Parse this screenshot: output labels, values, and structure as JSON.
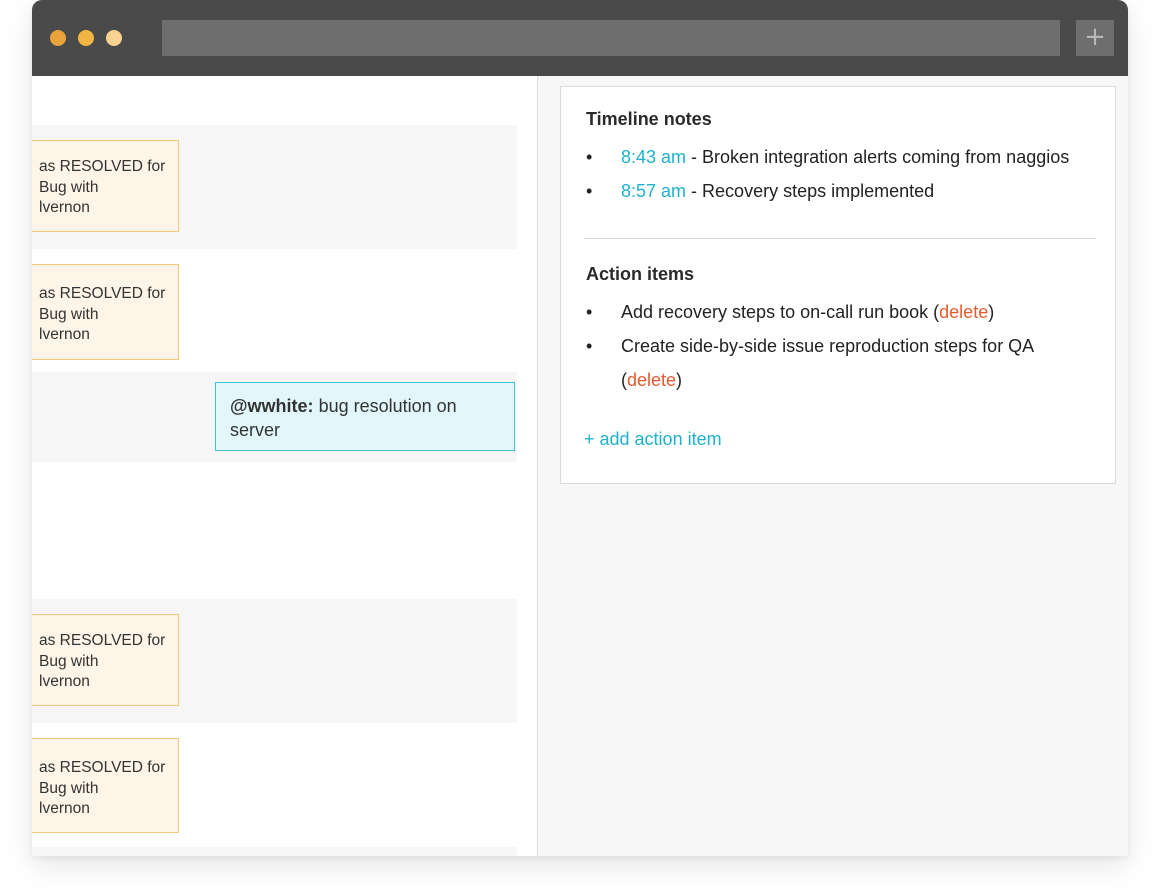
{
  "titlebar": {
    "new_tab_label": "+",
    "traffic_light_colors": [
      "#e8a33a",
      "#f2b544",
      "#f8d292"
    ]
  },
  "timeline": {
    "events": [
      {
        "lines": [
          "as RESOLVED for",
          "Bug with",
          "lvernon"
        ]
      },
      {
        "lines": [
          "as RESOLVED for",
          "Bug with",
          "lvernon"
        ]
      },
      {
        "lines": [
          "as RESOLVED for",
          "Bug with",
          "lvernon"
        ]
      },
      {
        "lines": [
          "as RESOLVED for",
          "Bug with",
          "lvernon"
        ]
      }
    ],
    "comment": {
      "author": "@wwhite:",
      "text": " bug resolution on server"
    }
  },
  "notes_panel": {
    "timeline_notes_title": "Timeline notes",
    "timeline_notes": [
      {
        "time": "8:43 am",
        "text": " - Broken integration alerts coming from naggios"
      },
      {
        "time": "8:57 am",
        "text": " - Recovery steps implemented"
      }
    ],
    "action_items_title": "Action items",
    "action_items": [
      {
        "text": "Add recovery steps to on-call run book (",
        "delete_label": "delete",
        "close": ")"
      },
      {
        "text": "Create side-by-side issue reproduction steps for QA (",
        "delete_label": "delete",
        "close": ")"
      }
    ],
    "add_action_label": "+ add action item"
  },
  "colors": {
    "accent": "#1fb2cc",
    "delete": "#e65a2e",
    "event_card_bg": "#fef5e8",
    "event_card_border": "#f6c77a",
    "comment_bg": "#e1f7fb",
    "comment_border": "#3ec2d8"
  }
}
